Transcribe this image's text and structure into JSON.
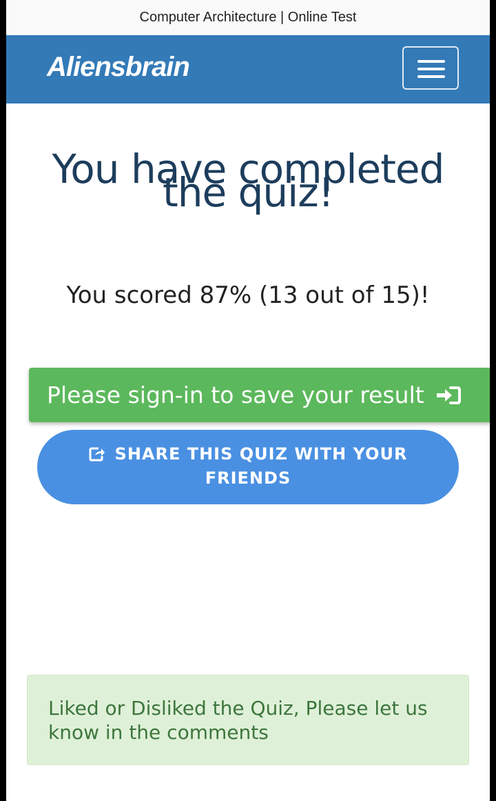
{
  "window": {
    "title": "Computer Architecture | Online Test"
  },
  "navbar": {
    "brand": "Aliensbrain",
    "menu_icon": "hamburger-menu-icon"
  },
  "quiz_result": {
    "heading_line1": "You have completed",
    "heading_line2": "the quiz!",
    "score_text": "You scored 87% (13 out of 15)!",
    "score_percent": 87,
    "correct": 13,
    "total": 15
  },
  "actions": {
    "signin_label": "Please sign-in to save your result",
    "signin_icon": "sign-in-icon",
    "share_label": "SHARE THIS QUIZ WITH YOUR FRIENDS",
    "share_icon": "share-icon"
  },
  "comments_notice": "Liked or Disliked the Quiz, Please let us know in the comments",
  "colors": {
    "navbar": "#337ab7",
    "signin_button": "#5cb85c",
    "share_button": "#4a90e2",
    "notice_bg": "#dff0d8",
    "notice_text": "#3c763d",
    "heading": "#1d3d5c"
  }
}
